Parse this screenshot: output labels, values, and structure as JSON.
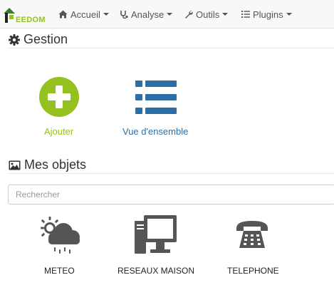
{
  "app": {
    "logo_text": "EEDOM",
    "accent": "#94c11f",
    "link_color": "#2c6fa6"
  },
  "navbar": {
    "items": [
      {
        "label": "Accueil",
        "icon": "home-icon"
      },
      {
        "label": "Analyse",
        "icon": "stethoscope-icon"
      },
      {
        "label": "Outils",
        "icon": "wrench-icon"
      },
      {
        "label": "Plugins",
        "icon": "tasks-icon"
      }
    ]
  },
  "gestion": {
    "title": "Gestion",
    "icon": "gear-icon",
    "actions": [
      {
        "label": "Ajouter",
        "icon": "plus-circle-icon"
      },
      {
        "label": "Vue d'ensemble",
        "icon": "list-icon"
      }
    ]
  },
  "objects": {
    "title": "Mes objets",
    "icon": "image-icon",
    "search_placeholder": "Rechercher",
    "items": [
      {
        "label": "METEO",
        "icon": "weather-icon"
      },
      {
        "label": "RESEAUX MAISON",
        "icon": "computer-icon"
      },
      {
        "label": "TELEPHONE",
        "icon": "telephone-icon"
      }
    ]
  }
}
